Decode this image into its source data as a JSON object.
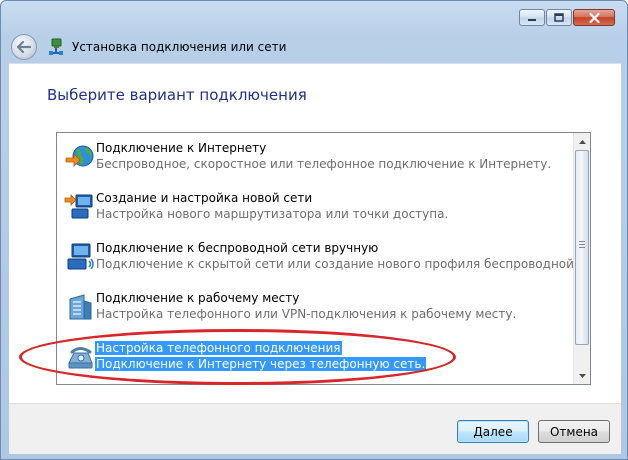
{
  "window": {
    "title": "Установка подключения или сети"
  },
  "icons": {
    "minimize": "minimize-icon",
    "maximize": "maximize-icon",
    "close": "close-icon",
    "back": "back-arrow-icon",
    "title": "network-setup-icon"
  },
  "content": {
    "heading": "Выберите вариант подключения"
  },
  "options": [
    {
      "title": "Подключение к Интернету",
      "description": "Беспроводное, скоростное или телефонное подключение к Интернету.",
      "icon": "internet-globe-icon"
    },
    {
      "title": "Создание и настройка новой сети",
      "description": "Настройка нового маршрутизатора или точки доступа.",
      "icon": "new-network-icon"
    },
    {
      "title": "Подключение к беспроводной сети вручную",
      "description": "Подключение к скрытой сети или создание нового профиля беспроводной связи.",
      "icon": "wireless-network-icon"
    },
    {
      "title": "Подключение к рабочему месту",
      "description": "Настройка телефонного или VPN-подключения к рабочему месту.",
      "icon": "workplace-building-icon"
    },
    {
      "title": "Настройка телефонного подключения",
      "description": "Подключение к Интернету через телефонную сеть.",
      "icon": "dialup-phone-icon",
      "selected": true
    }
  ],
  "buttons": {
    "next": "Далее",
    "cancel": "Отмена"
  },
  "colors": {
    "heading": "#1e3287",
    "selection": "#3399ff",
    "annotation": "#d7272b"
  }
}
